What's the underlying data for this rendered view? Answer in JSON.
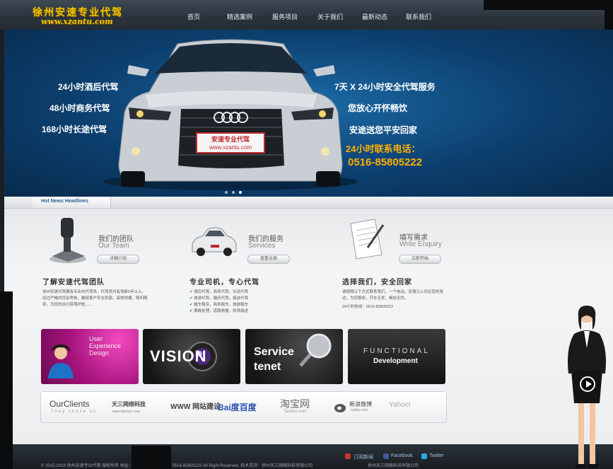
{
  "site": {
    "logo_title": "徐州安速专业代驾",
    "logo_url": "www.xzantu.com"
  },
  "nav": {
    "items": [
      {
        "label": "首页"
      },
      {
        "label": "精选案例"
      },
      {
        "label": "服务项目"
      },
      {
        "label": "关于我们"
      },
      {
        "label": "最新动态"
      },
      {
        "label": "联系我们"
      }
    ]
  },
  "banner": {
    "left_lines": [
      "24小时酒后代驾",
      "48小时商务代驾",
      "168小时长途代驾"
    ],
    "right_lines": [
      "7天 X 24小时安全代驾服务",
      "您放心开怀畅饮",
      "安途送您平安回家"
    ],
    "phone_label": "24小时联系电话：",
    "phone": "0516-85805222",
    "plate_title": "安速专业代驾",
    "plate_url": "www.xzantu.com",
    "slides": 3,
    "active_slide": 2
  },
  "news_bar": {
    "label": "Hot News Headlines"
  },
  "features": [
    {
      "title": "我们的团队",
      "subtitle": "Our Team",
      "button": "详细介绍",
      "icon": "gear-shift-icon"
    },
    {
      "title": "我们的服务",
      "subtitle": "Services",
      "button": "查看全部",
      "icon": "car-icon"
    },
    {
      "title": "填写需求",
      "subtitle": "Write Enquiry",
      "button": "立即开始",
      "icon": "document-pen-icon"
    }
  ],
  "sections": {
    "team": {
      "heading": "了解安速代驾团队",
      "text": "徐州安速代驾拥有专业的代驾员，代驾员均有驾龄5年以上，经过严格的培训考核，确保客户安全到家。高效快捷，随叫随到，为您的出行保驾护航……"
    },
    "service": {
      "heading": "专业司机，专心代驾",
      "items": [
        "酒后代驾，商务代驾，长途代驾",
        "旅游代驾，婚庆代驾，接送代驾",
        "婚车租赁，商务租车，旅游租车",
        "事故处理，道路救援，机场接送"
      ]
    },
    "choose": {
      "heading": "选择我们，安全回家",
      "text": "请按照以下方式联系我们，一个电话，安速马上到达您的身边，为您服务，开车无忧，畅饮无忧。",
      "phone_line": "24小时热线：0516-85805222"
    }
  },
  "tiles": [
    {
      "lines": [
        "User",
        "Experience",
        "Design"
      ]
    },
    {
      "text": "VISION"
    },
    {
      "lines": [
        "Service",
        "tenet"
      ]
    },
    {
      "lines": [
        "FUNCTIONAL",
        "Development"
      ]
    }
  ],
  "clients": {
    "title": "OurClients",
    "subtitle": "They chose us",
    "logos": [
      "天三网络科技",
      "WWW 网站建设",
      "Bai度百度",
      "淘宝网",
      "新浪微博",
      "Yahoo!"
    ],
    "logo_sub": [
      "www.tiansan.com",
      "",
      "",
      "Taobao.com",
      "weibo.com",
      ""
    ]
  },
  "footer": {
    "links": [
      "订阅新闻",
      "Facebook",
      "Twitter"
    ],
    "copyright": "© 2015-2018 徐州安速专业代驾 版权所有 地址：徐州市云龙区 电话：0516-85805222 All Right Reserved. 技术支持：徐州天三网络科技有限公司",
    "tech_support": "徐州天三网络科技有限公司"
  },
  "colors": {
    "header_bg": "#2f3841",
    "banner_bg": "#0c3f6e",
    "logo_yellow": "#f2c800",
    "phone_orange": "#ffae00",
    "tile_magenta": "#a6137c"
  }
}
